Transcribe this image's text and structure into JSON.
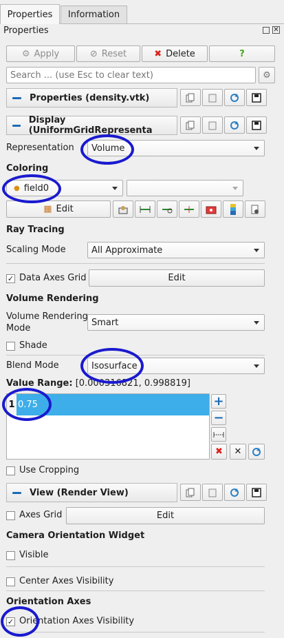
{
  "tabs": [
    {
      "label": "Properties"
    },
    {
      "label": "Information"
    }
  ],
  "panel": {
    "title": "Properties"
  },
  "toolbar": {
    "apply": "Apply",
    "reset": "Reset",
    "delete": "Delete",
    "help": "?"
  },
  "search": {
    "placeholder": "Search ... (use Esc to clear text)"
  },
  "sections": {
    "properties": "Properties (density.vtk)",
    "display": "Display (UniformGridRepresenta",
    "view": "View (Render View)"
  },
  "display": {
    "representation_label": "Representation",
    "representation_value": "Volume",
    "coloring_header": "Coloring",
    "coloring_value": "field0",
    "edit": "Edit",
    "ray_tracing_header": "Ray Tracing",
    "scaling_mode_label": "Scaling Mode",
    "scaling_mode_value": "All Approximate",
    "data_axes_grid_label": "Data Axes Grid",
    "data_axes_grid_checked": true,
    "data_axes_grid_edit": "Edit",
    "volume_rendering_header": "Volume Rendering",
    "vr_mode_label_1": "Volume Rendering",
    "vr_mode_label_2": "Mode",
    "vr_mode_value": "Smart",
    "shade_label": "Shade",
    "blend_mode_label": "Blend Mode",
    "blend_mode_value": "Isosurface",
    "value_range_label": "Value Range:",
    "value_range_value": "[0.000316821, 0.998819]",
    "values": [
      {
        "index": "1",
        "value": "0.75"
      }
    ],
    "use_cropping_label": "Use Cropping"
  },
  "view": {
    "axes_grid_label": "Axes Grid",
    "axes_grid_edit": "Edit",
    "camera_widget_header": "Camera Orientation Widget",
    "visible_label": "Visible",
    "center_axes_label": "Center Axes Visibility",
    "orientation_axes_header": "Orientation Axes",
    "orientation_axes_label": "Orientation Axes Visibility",
    "orientation_axes_checked": true
  },
  "colors": {
    "accent": "#1b6bb5",
    "selection": "#3daee9",
    "annotation_ring": "#1a1acf",
    "delete_red": "#d9231c"
  }
}
